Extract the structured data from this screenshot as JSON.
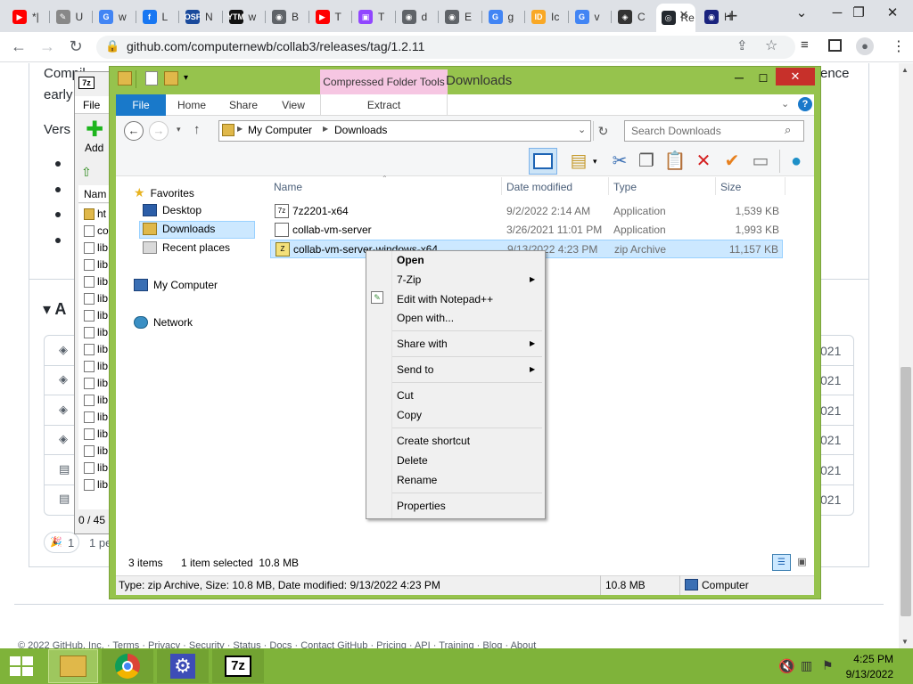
{
  "browser": {
    "tabs": [
      {
        "title": "*|",
        "color": "#ff0000",
        "glyph": "▶"
      },
      {
        "title": "U",
        "color": "#888888",
        "glyph": "✎"
      },
      {
        "title": "w",
        "color": "#4285f4",
        "glyph": "G"
      },
      {
        "title": "L",
        "color": "#1877f2",
        "glyph": "f"
      },
      {
        "title": "N",
        "color": "#1a4a9c",
        "glyph": "OSF"
      },
      {
        "title": "w",
        "color": "#111111",
        "glyph": "YTM"
      },
      {
        "title": "B",
        "color": "#5f6368",
        "glyph": "◉"
      },
      {
        "title": "T",
        "color": "#ff0000",
        "glyph": "▶"
      },
      {
        "title": "T",
        "color": "#9146ff",
        "glyph": "▣"
      },
      {
        "title": "d",
        "color": "#5f6368",
        "glyph": "◉"
      },
      {
        "title": "E",
        "color": "#5f6368",
        "glyph": "◉"
      },
      {
        "title": "g",
        "color": "#4285f4",
        "glyph": "G"
      },
      {
        "title": "Ic",
        "color": "#f9a825",
        "glyph": "ID"
      },
      {
        "title": "v",
        "color": "#4285f4",
        "glyph": "G"
      },
      {
        "title": "C",
        "color": "#333333",
        "glyph": "◈"
      },
      {
        "title": "Re",
        "color": "#24292f",
        "glyph": "◎"
      },
      {
        "title": "H",
        "color": "#1a237e",
        "glyph": "◉"
      }
    ],
    "url": "github.com/computernewb/collab3/releases/tag/1.2.11"
  },
  "webpage": {
    "text_fragments": [
      "Compil",
      "early",
      "Vers",
      "A",
      "ence",
      "021",
      "021",
      "021",
      "021",
      "021",
      "021",
      "1",
      "1 pe"
    ]
  },
  "sevenzip": {
    "file_menu": "File",
    "add_label": "Add",
    "col_name": "Nam",
    "rows": [
      "ht",
      "co",
      "lib",
      "lib",
      "lib",
      "lib",
      "lib",
      "lib",
      "lib",
      "lib",
      "lib",
      "lib",
      "lib",
      "lib",
      "lib",
      "lib",
      "lib"
    ],
    "status": "0 / 45"
  },
  "explorer": {
    "title": "Downloads",
    "context_tab": "Compressed Folder Tools",
    "ribbon_tabs": [
      "File",
      "Home",
      "Share",
      "View"
    ],
    "extract_tab": "Extract",
    "breadcrumb": [
      "My Computer",
      "Downloads"
    ],
    "search_placeholder": "Search Downloads",
    "nav": {
      "favorites": "Favorites",
      "desktop": "Desktop",
      "downloads": "Downloads",
      "recent": "Recent places",
      "computer": "My Computer",
      "network": "Network"
    },
    "columns": {
      "name": "Name",
      "date": "Date modified",
      "type": "Type",
      "size": "Size"
    },
    "files": [
      {
        "name": "7z2201-x64",
        "date": "9/2/2022 2:14 AM",
        "type": "Application",
        "size": "1,539 KB"
      },
      {
        "name": "collab-vm-server",
        "date": "3/26/2021 11:01 PM",
        "type": "Application",
        "size": "1,993 KB"
      },
      {
        "name": "collab-vm-server-windows-x64",
        "date": "9/13/2022 4:23 PM",
        "type": "zip Archive",
        "size": "11,157 KB"
      }
    ],
    "status_items": "3 items",
    "status_selected": "1 item selected  10.8 MB",
    "details_left": "Type: zip Archive, Size: 10.8 MB, Date modified: 9/13/2022 4:23 PM",
    "details_size": "10.8 MB",
    "details_location": "Computer"
  },
  "context_menu": {
    "open": "Open",
    "sevenzip": "7-Zip",
    "notepad": "Edit with Notepad++",
    "open_with": "Open with...",
    "share_with": "Share with",
    "send_to": "Send to",
    "cut": "Cut",
    "copy": "Copy",
    "create_shortcut": "Create shortcut",
    "delete": "Delete",
    "rename": "Rename",
    "properties": "Properties"
  },
  "taskbar": {
    "time": "4:25 PM",
    "date": "9/13/2022",
    "color": "#7fb33a"
  }
}
